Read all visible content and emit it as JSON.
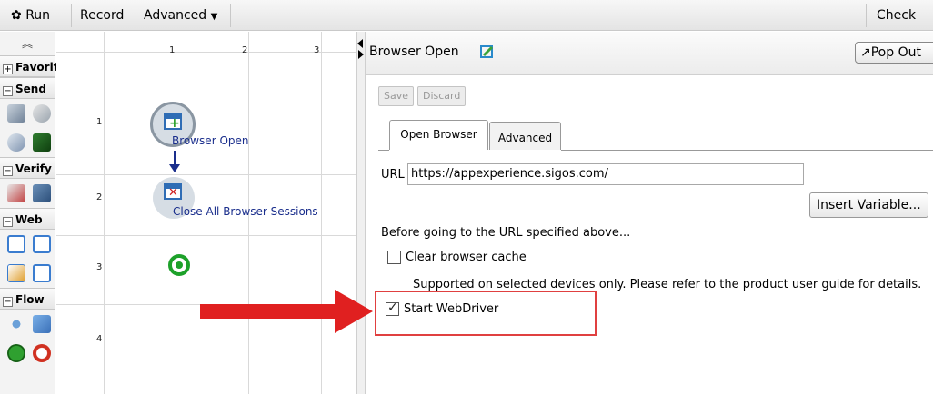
{
  "toolbar": {
    "run_label": "Run",
    "record_label": "Record",
    "advanced_label": "Advanced",
    "check_in_label": "Check in"
  },
  "palette": {
    "sections": [
      "Favorites",
      "Send",
      "Verify",
      "Web",
      "Flow"
    ],
    "collapse_symbol": "−",
    "expand_symbol": "+"
  },
  "canvas": {
    "columns": [
      "1",
      "2",
      "3"
    ],
    "rows": [
      "1",
      "2",
      "3",
      "4"
    ],
    "nodes": {
      "browser_open": "Browser Open",
      "close_sessions": "Close All Browser Sessions"
    }
  },
  "panel": {
    "title": "Browser Open",
    "pop_out_label": "Pop Out",
    "save_label": "Save",
    "discard_label": "Discard",
    "tabs": [
      "Open Browser",
      "Advanced"
    ],
    "url_label": "URL",
    "url_value": "https://appexperience.sigos.com/",
    "insert_variable_label": "Insert Variable...",
    "before_text": "Before going to the URL specified above...",
    "clear_cache_label": "Clear browser cache",
    "clear_cache_checked": false,
    "supported_note": "Supported on selected devices only. Please refer to the product user guide for details.",
    "start_webdriver_label": "Start WebDriver",
    "start_webdriver_checked": true
  },
  "colors": {
    "annotation_red": "#e02020",
    "node_blue": "#1a2e8c",
    "end_node_green": "#1da12a"
  }
}
